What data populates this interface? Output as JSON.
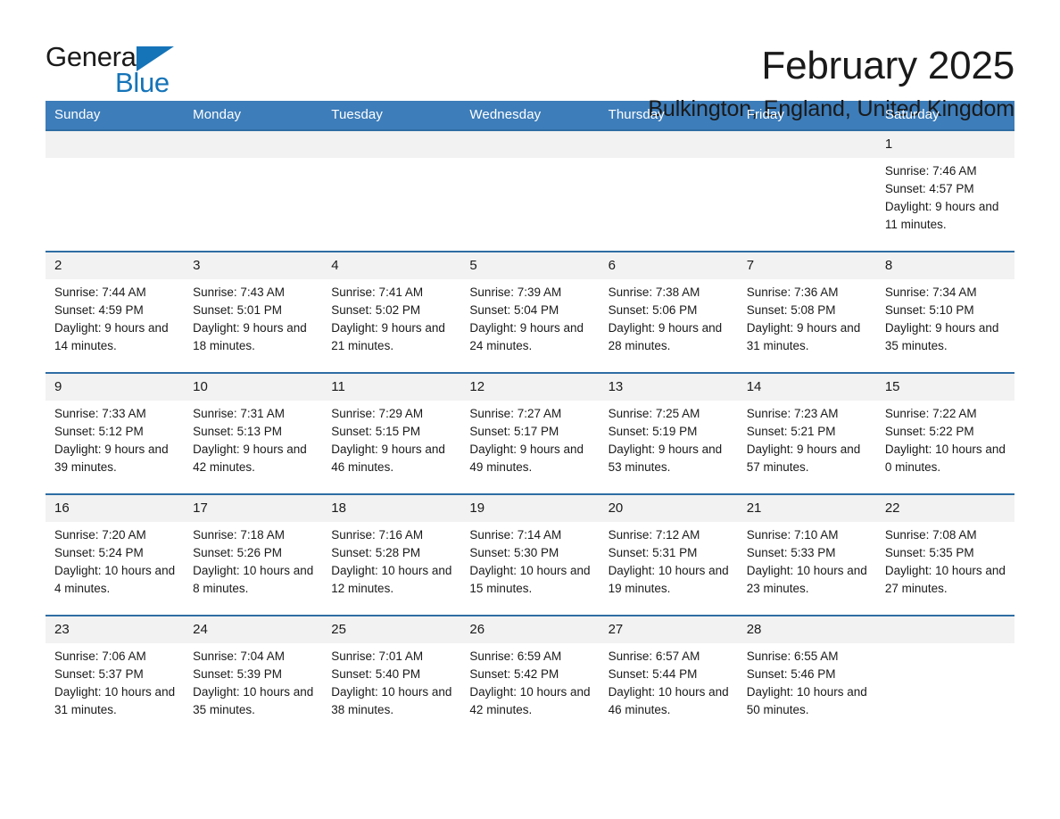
{
  "brand": {
    "name_part1": "General",
    "name_part2": "Blue",
    "accent_color": "#1574b8"
  },
  "header": {
    "month_title": "February 2025",
    "location": "Bulkington, England, United Kingdom"
  },
  "calendar": {
    "header_color": "#3d7dba",
    "row_divider_color": "#2e6da4",
    "day_number_bg": "#f2f2f2",
    "weekdays": [
      "Sunday",
      "Monday",
      "Tuesday",
      "Wednesday",
      "Thursday",
      "Friday",
      "Saturday"
    ],
    "weeks": [
      [
        {
          "day": "",
          "empty": true
        },
        {
          "day": "",
          "empty": true
        },
        {
          "day": "",
          "empty": true
        },
        {
          "day": "",
          "empty": true
        },
        {
          "day": "",
          "empty": true
        },
        {
          "day": "",
          "empty": true
        },
        {
          "day": "1",
          "sunrise": "Sunrise: 7:46 AM",
          "sunset": "Sunset: 4:57 PM",
          "daylight": "Daylight: 9 hours and 11 minutes."
        }
      ],
      [
        {
          "day": "2",
          "sunrise": "Sunrise: 7:44 AM",
          "sunset": "Sunset: 4:59 PM",
          "daylight": "Daylight: 9 hours and 14 minutes."
        },
        {
          "day": "3",
          "sunrise": "Sunrise: 7:43 AM",
          "sunset": "Sunset: 5:01 PM",
          "daylight": "Daylight: 9 hours and 18 minutes."
        },
        {
          "day": "4",
          "sunrise": "Sunrise: 7:41 AM",
          "sunset": "Sunset: 5:02 PM",
          "daylight": "Daylight: 9 hours and 21 minutes."
        },
        {
          "day": "5",
          "sunrise": "Sunrise: 7:39 AM",
          "sunset": "Sunset: 5:04 PM",
          "daylight": "Daylight: 9 hours and 24 minutes."
        },
        {
          "day": "6",
          "sunrise": "Sunrise: 7:38 AM",
          "sunset": "Sunset: 5:06 PM",
          "daylight": "Daylight: 9 hours and 28 minutes."
        },
        {
          "day": "7",
          "sunrise": "Sunrise: 7:36 AM",
          "sunset": "Sunset: 5:08 PM",
          "daylight": "Daylight: 9 hours and 31 minutes."
        },
        {
          "day": "8",
          "sunrise": "Sunrise: 7:34 AM",
          "sunset": "Sunset: 5:10 PM",
          "daylight": "Daylight: 9 hours and 35 minutes."
        }
      ],
      [
        {
          "day": "9",
          "sunrise": "Sunrise: 7:33 AM",
          "sunset": "Sunset: 5:12 PM",
          "daylight": "Daylight: 9 hours and 39 minutes."
        },
        {
          "day": "10",
          "sunrise": "Sunrise: 7:31 AM",
          "sunset": "Sunset: 5:13 PM",
          "daylight": "Daylight: 9 hours and 42 minutes."
        },
        {
          "day": "11",
          "sunrise": "Sunrise: 7:29 AM",
          "sunset": "Sunset: 5:15 PM",
          "daylight": "Daylight: 9 hours and 46 minutes."
        },
        {
          "day": "12",
          "sunrise": "Sunrise: 7:27 AM",
          "sunset": "Sunset: 5:17 PM",
          "daylight": "Daylight: 9 hours and 49 minutes."
        },
        {
          "day": "13",
          "sunrise": "Sunrise: 7:25 AM",
          "sunset": "Sunset: 5:19 PM",
          "daylight": "Daylight: 9 hours and 53 minutes."
        },
        {
          "day": "14",
          "sunrise": "Sunrise: 7:23 AM",
          "sunset": "Sunset: 5:21 PM",
          "daylight": "Daylight: 9 hours and 57 minutes."
        },
        {
          "day": "15",
          "sunrise": "Sunrise: 7:22 AM",
          "sunset": "Sunset: 5:22 PM",
          "daylight": "Daylight: 10 hours and 0 minutes."
        }
      ],
      [
        {
          "day": "16",
          "sunrise": "Sunrise: 7:20 AM",
          "sunset": "Sunset: 5:24 PM",
          "daylight": "Daylight: 10 hours and 4 minutes."
        },
        {
          "day": "17",
          "sunrise": "Sunrise: 7:18 AM",
          "sunset": "Sunset: 5:26 PM",
          "daylight": "Daylight: 10 hours and 8 minutes."
        },
        {
          "day": "18",
          "sunrise": "Sunrise: 7:16 AM",
          "sunset": "Sunset: 5:28 PM",
          "daylight": "Daylight: 10 hours and 12 minutes."
        },
        {
          "day": "19",
          "sunrise": "Sunrise: 7:14 AM",
          "sunset": "Sunset: 5:30 PM",
          "daylight": "Daylight: 10 hours and 15 minutes."
        },
        {
          "day": "20",
          "sunrise": "Sunrise: 7:12 AM",
          "sunset": "Sunset: 5:31 PM",
          "daylight": "Daylight: 10 hours and 19 minutes."
        },
        {
          "day": "21",
          "sunrise": "Sunrise: 7:10 AM",
          "sunset": "Sunset: 5:33 PM",
          "daylight": "Daylight: 10 hours and 23 minutes."
        },
        {
          "day": "22",
          "sunrise": "Sunrise: 7:08 AM",
          "sunset": "Sunset: 5:35 PM",
          "daylight": "Daylight: 10 hours and 27 minutes."
        }
      ],
      [
        {
          "day": "23",
          "sunrise": "Sunrise: 7:06 AM",
          "sunset": "Sunset: 5:37 PM",
          "daylight": "Daylight: 10 hours and 31 minutes."
        },
        {
          "day": "24",
          "sunrise": "Sunrise: 7:04 AM",
          "sunset": "Sunset: 5:39 PM",
          "daylight": "Daylight: 10 hours and 35 minutes."
        },
        {
          "day": "25",
          "sunrise": "Sunrise: 7:01 AM",
          "sunset": "Sunset: 5:40 PM",
          "daylight": "Daylight: 10 hours and 38 minutes."
        },
        {
          "day": "26",
          "sunrise": "Sunrise: 6:59 AM",
          "sunset": "Sunset: 5:42 PM",
          "daylight": "Daylight: 10 hours and 42 minutes."
        },
        {
          "day": "27",
          "sunrise": "Sunrise: 6:57 AM",
          "sunset": "Sunset: 5:44 PM",
          "daylight": "Daylight: 10 hours and 46 minutes."
        },
        {
          "day": "28",
          "sunrise": "Sunrise: 6:55 AM",
          "sunset": "Sunset: 5:46 PM",
          "daylight": "Daylight: 10 hours and 50 minutes."
        },
        {
          "day": "",
          "empty": true
        }
      ]
    ]
  }
}
